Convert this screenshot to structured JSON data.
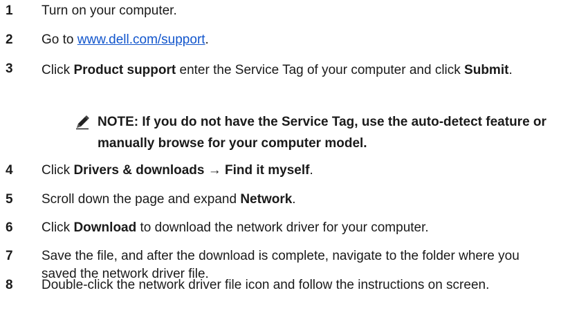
{
  "steps": [
    {
      "number": "1",
      "parts": [
        {
          "t": "Turn on your computer.",
          "b": false
        }
      ]
    },
    {
      "number": "2",
      "parts": [
        {
          "t": "Go to ",
          "b": false
        },
        {
          "t": "www.dell.com/support",
          "link": true
        },
        {
          "t": ".",
          "b": false
        }
      ]
    },
    {
      "number": "3",
      "parts": [
        {
          "t": "Click ",
          "b": false
        },
        {
          "t": "Product support",
          "b": true
        },
        {
          "t": " enter the Service Tag of your computer and click ",
          "b": false
        },
        {
          "t": "Submit",
          "b": true
        },
        {
          "t": ".",
          "b": false
        }
      ]
    },
    {
      "number": "4",
      "parts": [
        {
          "t": "Click ",
          "b": false
        },
        {
          "t": "Drivers & downloads",
          "b": true
        },
        {
          "t": " → ",
          "b": false
        },
        {
          "t": "Find it myself",
          "b": true
        },
        {
          "t": ".",
          "b": false
        }
      ]
    },
    {
      "number": "5",
      "parts": [
        {
          "t": "Scroll down the page and expand ",
          "b": false
        },
        {
          "t": "Network",
          "b": true
        },
        {
          "t": ".",
          "b": false
        }
      ]
    },
    {
      "number": "6",
      "parts": [
        {
          "t": "Click ",
          "b": false
        },
        {
          "t": "Download",
          "b": true
        },
        {
          "t": " to download the network driver for your computer.",
          "b": false
        }
      ]
    },
    {
      "number": "7",
      "parts": [
        {
          "t": "Save the file, and after the download is complete, navigate to the folder where you saved the network driver file.",
          "b": false
        }
      ]
    },
    {
      "number": "8",
      "parts": [
        {
          "t": "Double-click the network driver file icon and follow the instructions on screen.",
          "b": false
        }
      ]
    }
  ],
  "note": {
    "icon": "pencil-note-icon",
    "text": "NOTE: If you do not have the Service Tag, use the auto-detect feature or manually browse for your computer model."
  },
  "colors": {
    "link": "#1155cc",
    "text": "#1a1a1a"
  }
}
